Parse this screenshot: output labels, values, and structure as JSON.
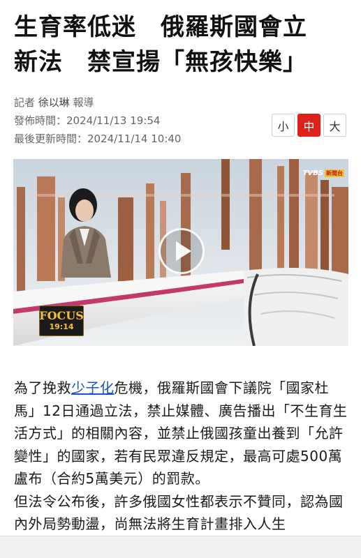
{
  "headline": {
    "line1": "生育率低迷　俄羅斯國會立",
    "line2": "新法　禁宣揚「無孩快樂」"
  },
  "meta": {
    "reporter_prefix": "記者",
    "reporter_name": "徐以琳",
    "reporter_suffix": "報導",
    "published_label": "發佈時間：",
    "published_value": "2024/11/13 19:54",
    "updated_label": "最後更新時間：",
    "updated_value": "2024/11/14 10:40"
  },
  "font_size_controls": {
    "small": "小",
    "medium": "中",
    "large": "大",
    "active": "medium"
  },
  "video": {
    "channel_logo": "TVBS",
    "channel_tag": "新聞台",
    "program_logo_word": "FOCUS",
    "program_time": "19:14",
    "play_icon": "play-icon"
  },
  "article": {
    "p1_before": "為了挽救",
    "p1_keyword": "少子化",
    "p1_after": "危機，俄羅斯國會下議院「國家杜馬」12日通過立法，禁止媒體、廣告播出「不生育生活方式」的相關內容，並禁止俄國孩童出養到「允許變性」的國家，若有民眾違反規定，最高可處500萬盧布（合約5萬美元）的罰款。",
    "p2": "但法令公布後，許多俄國女性都表示不贊同，認為國內外局勢動盪，尚無法將生育計畫排入人生"
  },
  "colors": {
    "accent_red": "#e0201b",
    "link_blue": "#1a55c4"
  }
}
